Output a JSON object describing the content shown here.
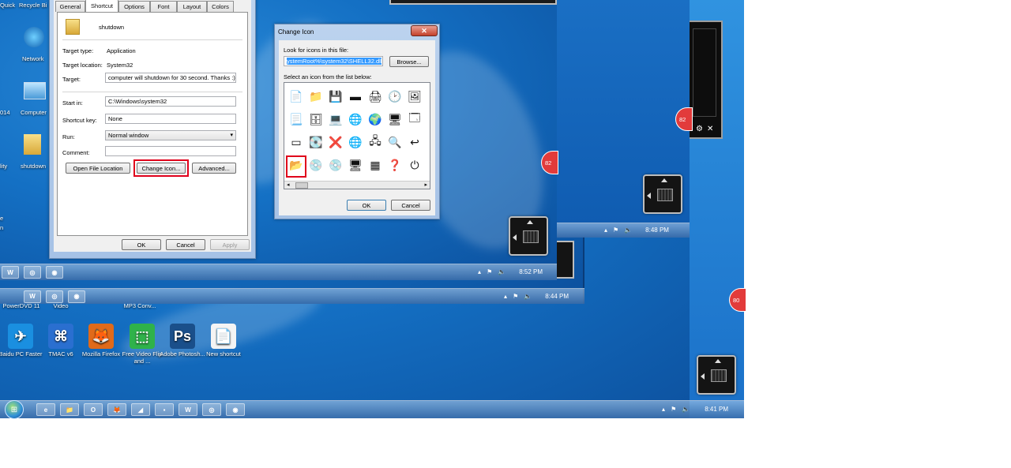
{
  "desktop": {
    "left_labels": [
      "Quick",
      "Recycle Bi",
      "Network",
      "Computer",
      "shutdown",
      "lity",
      "014",
      "e",
      "n"
    ],
    "icons_row": [
      {
        "label": "PowerDVD 11",
        "glyph": "▶",
        "color": "#3a3a3a"
      },
      {
        "label": "Video",
        "glyph": "🎬",
        "color": "#444"
      },
      {
        "label": "MP3 Conv...",
        "glyph": "♫",
        "color": "#555"
      }
    ],
    "icons": [
      {
        "label": "Baidu PC Faster",
        "glyph": "✈",
        "color": "#1a8fe0"
      },
      {
        "label": "TMAC v6",
        "glyph": "⌘",
        "color": "#2a6fd0"
      },
      {
        "label": "Mozilla Firefox",
        "glyph": "🦊",
        "color": "#e06a1a"
      },
      {
        "label": "Free Video Flip and ...",
        "glyph": "⬚",
        "color": "#2fb24a"
      },
      {
        "label": "Adobe Photosh...",
        "glyph": "Ps",
        "color": "#1a4f8a"
      },
      {
        "label": "New shortcut",
        "glyph": "📄",
        "color": "#f4f4f4"
      }
    ]
  },
  "taskbars": {
    "bottom": {
      "clock": "8:41 PM",
      "items": [
        "e",
        "📁",
        "O",
        "🦊",
        "◢",
        "▪",
        "W",
        "◎",
        "◉"
      ]
    },
    "mid1": {
      "clock": "8:52 PM",
      "items": [
        "W",
        "◎",
        "◉"
      ]
    },
    "mid2": {
      "clock": "8:44 PM",
      "items": [
        "W",
        "◎",
        "◉"
      ]
    },
    "right": {
      "clock": "8:48 PM"
    }
  },
  "badges": [
    "82",
    "82",
    "80"
  ],
  "properties": {
    "tabs": [
      "General",
      "Shortcut",
      "Options",
      "Font",
      "Layout",
      "Colors"
    ],
    "active_tab": "Shortcut",
    "name": "shutdown",
    "fields": {
      "target_type_label": "Target type:",
      "target_type": "Application",
      "target_location_label": "Target location:",
      "target_location": "System32",
      "target_label": "Target:",
      "target": "computer will shutdown for 30 second. Thanks :)\"",
      "start_in_label": "Start in:",
      "start_in": "C:\\Windows\\system32",
      "shortcut_key_label": "Shortcut key:",
      "shortcut_key": "None",
      "run_label": "Run:",
      "run": "Normal window",
      "comment_label": "Comment:",
      "comment": ""
    },
    "buttons": {
      "open_file_location": "Open File Location",
      "change_icon": "Change Icon...",
      "advanced": "Advanced...",
      "ok": "OK",
      "cancel": "Cancel",
      "apply": "Apply"
    }
  },
  "change_icon": {
    "title": "Change Icon",
    "look_label": "Look for icons in this file:",
    "file_path": "ystemRoot%\\system32\\SHELL32.dll",
    "browse": "Browse...",
    "select_label": "Select an icon from the list below:",
    "icons": [
      [
        "📄",
        "📁",
        "💾",
        "▬",
        "🖨",
        "🕑",
        "🖼"
      ],
      [
        "📃",
        "🗄",
        "💻",
        "🌐",
        "🌍",
        "🖥",
        "🗔"
      ],
      [
        "▭",
        "💽",
        "❌",
        "🌐",
        "🖧",
        "🔍",
        "↩"
      ],
      [
        "📂",
        "💿",
        "💿",
        "🖥",
        "▦",
        "❓",
        "⏻"
      ]
    ],
    "ok": "OK",
    "cancel": "Cancel"
  }
}
